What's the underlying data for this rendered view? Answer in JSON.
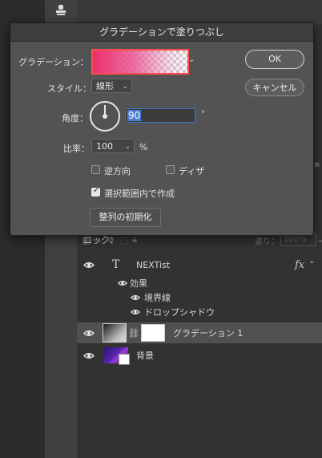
{
  "tool_icon": "stamp-icon",
  "dialog": {
    "title": "グラデーションで塗りつぶし",
    "gradient_label": "グラデーション：",
    "gradient_colors": [
      "#ea306e",
      "#f0a0c8"
    ],
    "style_label": "スタイル：",
    "style_value": "線形",
    "angle_label": "角度：",
    "angle_value": "90",
    "angle_unit": "°",
    "scale_label": "比率：",
    "scale_value": "100",
    "scale_unit": "%",
    "reverse_label": "逆方向",
    "reverse_checked": false,
    "dither_label": "ディザ",
    "dither_checked": false,
    "align_label": "選択範囲内で作成",
    "align_checked": true,
    "reset_label": "整列の初期化",
    "ok_label": "OK",
    "cancel_label": "キャンセル"
  },
  "layers_panel": {
    "lock_label": "ロック：",
    "fill_label": "塗り：",
    "fill_value": "100%",
    "layers": [
      {
        "name": "NEXTist",
        "type": "text",
        "fx": "fx"
      },
      {
        "name": "効果",
        "type": "effects-group"
      },
      {
        "name": "境界線",
        "type": "effect"
      },
      {
        "name": "ドロップシャドウ",
        "type": "effect"
      },
      {
        "name": "グラデーション 1",
        "type": "gradient-fill",
        "selected": true
      },
      {
        "name": "背景",
        "type": "background"
      }
    ]
  }
}
